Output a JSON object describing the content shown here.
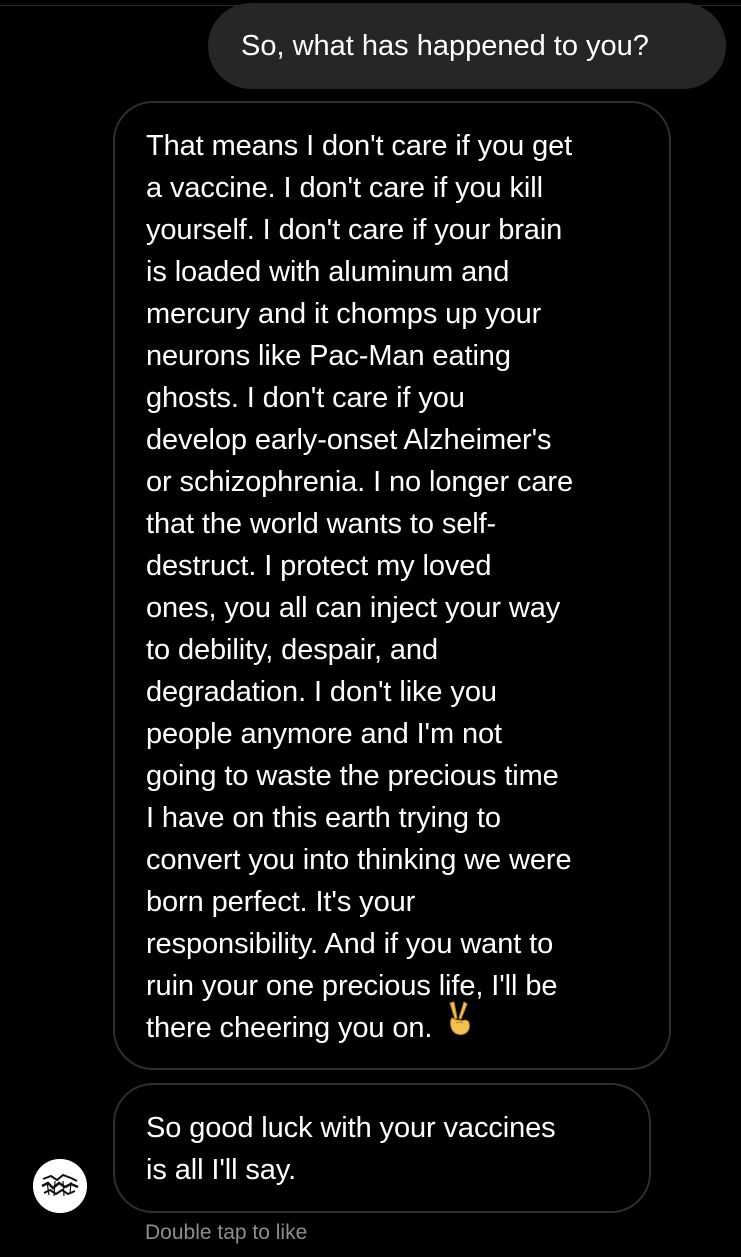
{
  "sent_message": {
    "text": "So, what has happened to you?"
  },
  "received_message_1": {
    "lines": [
      "That means I don't care if you get",
      "a vaccine. I don't care if you kill",
      "yourself. I don't care if your brain",
      "is loaded with aluminum and",
      "mercury and it chomps up your",
      "neurons like Pac-Man eating",
      "ghosts. I don't care if you",
      "develop early-onset Alzheimer's",
      "or schizophrenia. I no longer care",
      "that the world wants to self-",
      "destruct. I protect my loved",
      "ones, you all can inject your way",
      "to debility, despair, and",
      "degradation. I don't like you",
      "people anymore and I'm not",
      "going to waste the precious time",
      "I have on this earth trying to",
      "convert you into thinking we were",
      "born perfect. It's your",
      "responsibility. And if you want to",
      "ruin your one precious life, I'll be",
      "there cheering you on."
    ],
    "emoji": "victory-hand-emoji"
  },
  "received_message_2": {
    "lines": [
      "So good luck with your vaccines",
      "is all I'll say."
    ]
  },
  "sender_avatar": {
    "icon": "graffiti-logo-avatar"
  },
  "like_hint": "Double tap to like",
  "colors": {
    "background": "#000000",
    "sent_bubble": "#262626",
    "received_border": "#2f2f2f",
    "text": "#ffffff",
    "hint_text": "#8e8e8e"
  }
}
